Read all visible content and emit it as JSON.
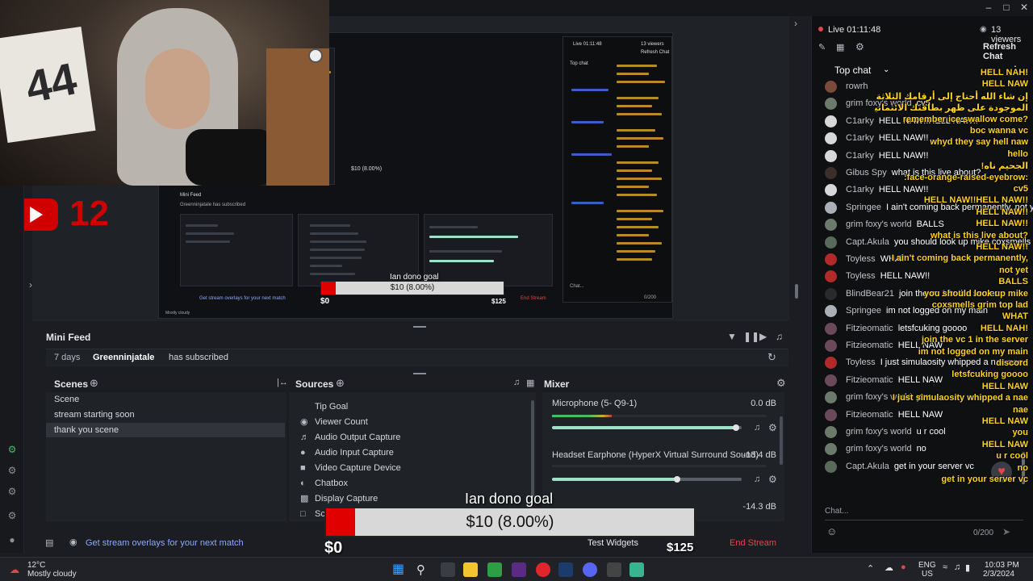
{
  "preview": {
    "mini_feed_title": "Mini Feed",
    "feed_time": "7 days",
    "feed_user": "Greenninjatale",
    "feed_action": "has subscribed",
    "nested_live": "Live 01:11:48",
    "nested_viewers": "13 viewers",
    "nested_refresh": "Refresh Chat",
    "nested_top_chat": "Top chat",
    "nested_goal_title": "Ian dono goal",
    "nested_goal_text": "$10 (8.00%)",
    "nested_goal_min": "$0",
    "nested_goal_max": "$125",
    "nested_overlay_text": "Get stream overlays for your next match",
    "nested_end": "End Stream",
    "nested_weather": "Mostly cloudy",
    "nested_count": "0/200",
    "nested_chat_placeholder": "Chat..."
  },
  "youtube_badge": {
    "count": "12"
  },
  "scenes": {
    "title": "Scenes",
    "items": [
      "Scene",
      "stream starting soon",
      "thank you scene"
    ],
    "selected_index": 2
  },
  "sources": {
    "title": "Sources",
    "items": [
      {
        "label": "Tip Goal",
        "icon": "browser"
      },
      {
        "label": "Viewer Count",
        "icon": "eye"
      },
      {
        "label": "Audio Output Capture",
        "icon": "speaker"
      },
      {
        "label": "Audio Input Capture",
        "icon": "microphone"
      },
      {
        "label": "Video Capture Device",
        "icon": "camera"
      },
      {
        "label": "Chatbox",
        "icon": "browser"
      },
      {
        "label": "Display Capture",
        "icon": "monitor"
      },
      {
        "label": "Scre",
        "icon": "scene"
      }
    ]
  },
  "mixer": {
    "title": "Mixer",
    "channels": [
      {
        "name": "Microphone (5- Q9-1)",
        "db": "0.0 dB",
        "level": 0.97
      },
      {
        "name": "Headset Earphone (HyperX Virtual Surround Sound)",
        "db": "-13.4 dB",
        "level": 0.66
      }
    ],
    "third_db": "-14.3 dB"
  },
  "statusbar": {
    "overlay_link": "Get stream overlays for your next match",
    "test_widgets": "Test Widgets",
    "end_stream": "End Stream"
  },
  "goal": {
    "title": "Ian dono goal",
    "text": "$10 (8.00%)",
    "min": "$0",
    "max": "$125",
    "percent": 8
  },
  "chat": {
    "live": "Live 01:11:48",
    "viewers": "13 viewers",
    "refresh": "Refresh Chat",
    "top_chat": "Top chat",
    "placeholder": "Chat...",
    "counter": "0/200",
    "messages": [
      {
        "author": "rowrh",
        "text": "",
        "avatar": "#7a4a3a"
      },
      {
        "author": "grim foxy's world",
        "text": "cv5",
        "avatar": "#6b7a6b"
      },
      {
        "author": "C1arky",
        "text": "HELL NAW!!HELL NAW!!",
        "avatar": "#d8d8d8"
      },
      {
        "author": "C1arky",
        "text": "HELL NAW!!",
        "avatar": "#d8d8d8"
      },
      {
        "author": "C1arky",
        "text": "HELL NAW!!",
        "avatar": "#d8d8d8"
      },
      {
        "author": "Gibus Spy",
        "text": "what is this live about?",
        "avatar": "#3a2f2a"
      },
      {
        "author": "C1arky",
        "text": "HELL NAW!!",
        "avatar": "#d8d8d8"
      },
      {
        "author": "Springee",
        "text": "I ain't coming back permanently, not yet",
        "avatar": "#aab0b8"
      },
      {
        "author": "grim foxy's world",
        "text": "BALLS",
        "avatar": "#6b7a6b"
      },
      {
        "author": "Capt.Akula",
        "text": "you should look up mike coxsmells grim top lad",
        "avatar": "#5a6a5a"
      },
      {
        "author": "Toyless",
        "text": "WHAT",
        "avatar": "#b02a2a"
      },
      {
        "author": "Toyless",
        "text": "HELL NAW!!",
        "avatar": "#b02a2a"
      },
      {
        "author": "BlindBear21",
        "text": "join the vc 1 in the server",
        "avatar": "#2a2a2a"
      },
      {
        "author": "Springee",
        "text": "im not logged on my main",
        "avatar": "#aab0b8"
      },
      {
        "author": "Fitzieomatic",
        "text": "letsfcuking goooo",
        "avatar": "#6a4a5a"
      },
      {
        "author": "Fitzieomatic",
        "text": "HELL NAW",
        "avatar": "#6a4a5a"
      },
      {
        "author": "Toyless",
        "text": "I just simulaosity whipped a nae nae",
        "avatar": "#b02a2a"
      },
      {
        "author": "Fitzieomatic",
        "text": "HELL NAW",
        "avatar": "#6a4a5a"
      },
      {
        "author": "grim foxy's world",
        "text": "you",
        "avatar": "#6b7a6b"
      },
      {
        "author": "Fitzieomatic",
        "text": "HELL NAW",
        "avatar": "#6a4a5a"
      },
      {
        "author": "grim foxy's world",
        "text": "u r cool",
        "avatar": "#6b7a6b"
      },
      {
        "author": "grim foxy's world",
        "text": "no",
        "avatar": "#6b7a6b"
      },
      {
        "author": "Capt.Akula",
        "text": "get in your server vc",
        "avatar": "#5a6a5a"
      }
    ]
  },
  "overlay_chat": [
    {
      "text": "HELL NAH!",
      "color": "yellow"
    },
    {
      "text": "HELL NAW",
      "color": "yellow"
    },
    {
      "text": "إن شاء الله أحتاج إلى أرقامك الثلاثة الغريبة",
      "color": "yellow"
    },
    {
      "text": "الموجودة على ظهر بطاقتك الائتمانية لإنقاذ ماما",
      "color": "yellow"
    },
    {
      "text": "remember ice swallow come?",
      "color": "yellow"
    },
    {
      "text": "boc wanna vc",
      "color": "yellow"
    },
    {
      "text": "whyd they say hell naw",
      "color": "yellow"
    },
    {
      "text": "hello",
      "color": "yellow"
    },
    {
      "text": "!الجحيم ناه",
      "color": "yellow"
    },
    {
      "text": ":face-orange-raised-eyebrow:",
      "color": "yellow"
    },
    {
      "text": "cv5",
      "color": "yellow"
    },
    {
      "text": "HELL NAW!!HELL NAW!!",
      "color": "yellow"
    },
    {
      "text": "HELL NAW!!",
      "color": "yellow"
    },
    {
      "text": "HELL NAW!!",
      "color": "yellow"
    },
    {
      "text": "what is this live about?",
      "color": "yellow"
    },
    {
      "text": "HELL NAW!!",
      "color": "yellow"
    },
    {
      "text": "I ain't coming back permanently,",
      "color": "yellow"
    },
    {
      "text": "not yet",
      "color": "yellow"
    },
    {
      "text": "BALLS",
      "color": "yellow"
    },
    {
      "text": "you should look up mike",
      "color": "yellow"
    },
    {
      "text": "coxsmells grim top lad",
      "color": "yellow"
    },
    {
      "text": "WHAT",
      "color": "yellow"
    },
    {
      "text": "HELL NAH!",
      "color": "yellow"
    },
    {
      "text": "join the vc 1 in the server",
      "color": "yellow"
    },
    {
      "text": "im not logged on my main",
      "color": "yellow"
    },
    {
      "text": "discord",
      "color": "yellow"
    },
    {
      "text": "letsfcuking goooo",
      "color": "yellow"
    },
    {
      "text": "HELL NAW",
      "color": "yellow"
    },
    {
      "text": "I just simulaosity whipped a nae",
      "color": "yellow"
    },
    {
      "text": "nae",
      "color": "yellow"
    },
    {
      "text": "HELL NAW",
      "color": "yellow"
    },
    {
      "text": "you",
      "color": "yellow"
    },
    {
      "text": "HELL NAW",
      "color": "yellow"
    },
    {
      "text": "u r cool",
      "color": "yellow"
    },
    {
      "text": "no",
      "color": "yellow"
    },
    {
      "text": "get in your server vc",
      "color": "yellow"
    }
  ],
  "taskbar": {
    "weather_temp": "12°C",
    "weather_desc": "Mostly cloudy",
    "lang": "ENG",
    "region": "US",
    "time": "10:03 PM",
    "date": "2/3/2024"
  },
  "colors": {
    "accent_red": "#e00000",
    "end_stream": "#e0464b",
    "overlay_yellow": "#ffd21e"
  }
}
